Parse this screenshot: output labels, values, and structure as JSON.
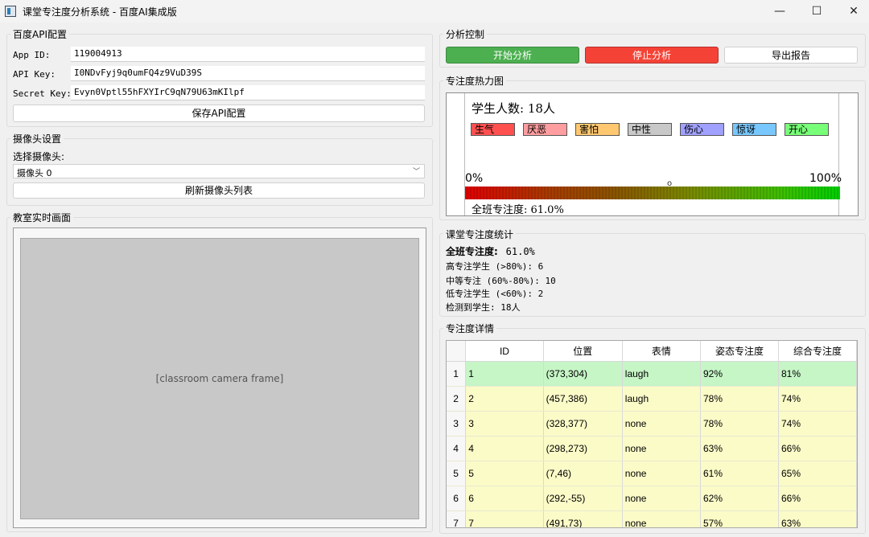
{
  "window": {
    "title": "课堂专注度分析系统 - 百度AI集成版",
    "minimize": "—",
    "maximize": "☐",
    "close": "✕"
  },
  "api": {
    "group_title": "百度API配置",
    "app_id_label": "App ID:",
    "app_id": "119004913",
    "api_key_label": "API Key:",
    "api_key": "I0NDvFyj9q0umFQ4z9VuD39S",
    "secret_key_label": "Secret Key:",
    "secret_key": "Evyn0Vptl55hFXYIrC9qN79U63mKIlpf",
    "save_label": "保存API配置"
  },
  "camera": {
    "group_title": "摄像头设置",
    "select_label": "选择摄像头:",
    "selected": "摄像头 0",
    "refresh_label": "刷新摄像头列表"
  },
  "live": {
    "group_title": "教室实时画面",
    "placeholder": "[classroom camera frame]"
  },
  "control": {
    "group_title": "分析控制",
    "start_label": "开始分析",
    "stop_label": "停止分析",
    "export_label": "导出报告",
    "start_color": "#4caf50",
    "stop_color": "#f44336"
  },
  "heatmap": {
    "group_title": "专注度热力图",
    "student_count_text": "学生人数: 18人",
    "emotions": [
      {
        "label": "生气",
        "color": "#ff5050"
      },
      {
        "label": "厌恶",
        "color": "#ff9ea0"
      },
      {
        "label": "害怕",
        "color": "#ffc870"
      },
      {
        "label": "中性",
        "color": "#c8c8c8"
      },
      {
        "label": "伤心",
        "color": "#a0a0ff"
      },
      {
        "label": "惊讶",
        "color": "#78c8ff"
      },
      {
        "label": "开心",
        "color": "#78ff78"
      }
    ],
    "scale_min": "0%",
    "scale_max": "100%",
    "marker_char": "o",
    "class_attention_text": "全班专注度:  61.0%",
    "class_attention": 0.61
  },
  "stats": {
    "group_title": "课堂专注度统计",
    "overall_label": "全班专注度:",
    "overall_value": "61.0%",
    "high": "高专注学生 (>80%): 6",
    "medium": "中等专注 (60%-80%): 10",
    "low": "低专注学生 (<60%): 2",
    "detected": "检测到学生: 18人"
  },
  "details": {
    "group_title": "专注度详情",
    "columns": [
      "ID",
      "位置",
      "表情",
      "姿态专注度",
      "综合专注度"
    ],
    "rows": [
      {
        "n": "1",
        "id": "1",
        "pos": "(373,304)",
        "expr": "laugh",
        "pose": "92%",
        "total": "81%",
        "color": "#c6f5c6"
      },
      {
        "n": "2",
        "id": "2",
        "pos": "(457,386)",
        "expr": "laugh",
        "pose": "78%",
        "total": "74%",
        "color": "#fbfbc8"
      },
      {
        "n": "3",
        "id": "3",
        "pos": "(328,377)",
        "expr": "none",
        "pose": "78%",
        "total": "74%",
        "color": "#fbfbc8"
      },
      {
        "n": "4",
        "id": "4",
        "pos": "(298,273)",
        "expr": "none",
        "pose": "63%",
        "total": "66%",
        "color": "#fbfbc8"
      },
      {
        "n": "5",
        "id": "5",
        "pos": "(7,46)",
        "expr": "none",
        "pose": "61%",
        "total": "65%",
        "color": "#fbfbc8"
      },
      {
        "n": "6",
        "id": "6",
        "pos": "(292,-55)",
        "expr": "none",
        "pose": "62%",
        "total": "66%",
        "color": "#fbfbc8"
      },
      {
        "n": "7",
        "id": "7",
        "pos": "(491,73)",
        "expr": "none",
        "pose": "57%",
        "total": "63%",
        "color": "#fbfbc8"
      }
    ]
  }
}
